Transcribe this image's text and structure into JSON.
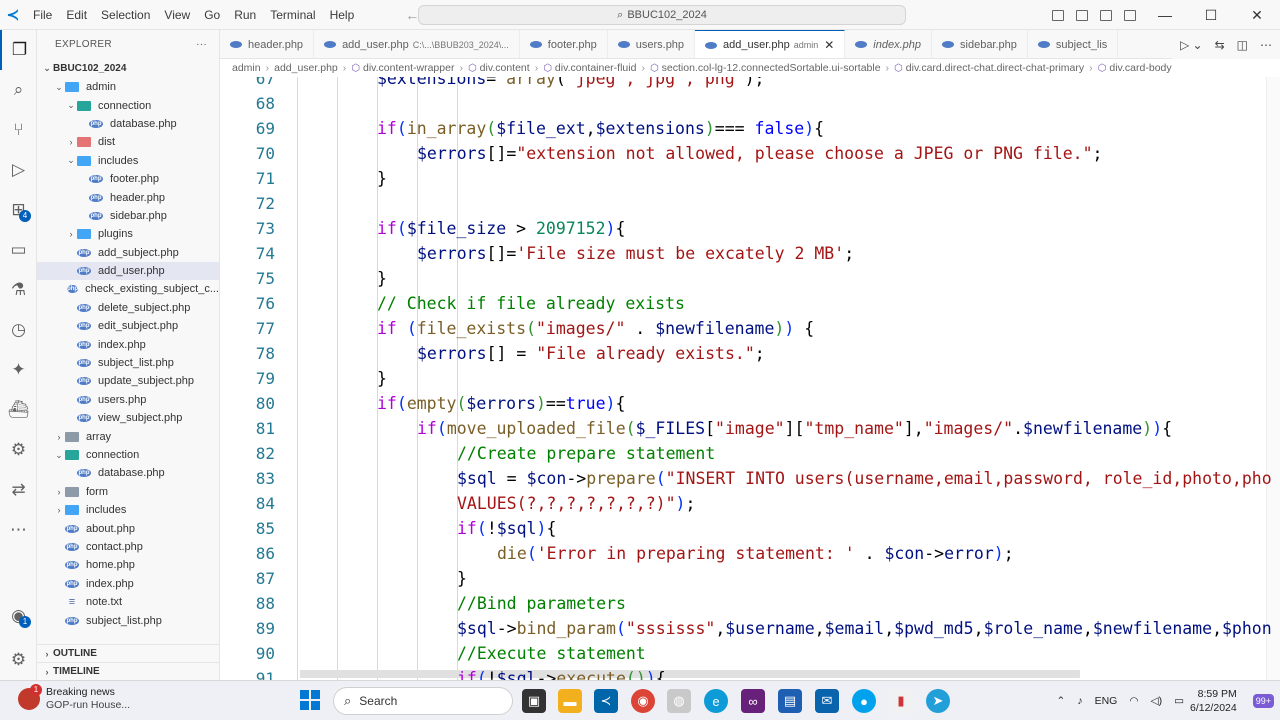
{
  "titlebar": {
    "menu": [
      "File",
      "Edit",
      "Selection",
      "View",
      "Go",
      "Run",
      "Terminal",
      "Help"
    ],
    "search_text": "BBUC102_2024"
  },
  "sidebar": {
    "header": "EXPLORER",
    "more": "···",
    "root": "BBUC102_2024",
    "tree": [
      {
        "label": "admin",
        "depth": 1,
        "kind": "folder",
        "color": "blue",
        "open": true
      },
      {
        "label": "connection",
        "depth": 2,
        "kind": "folder",
        "color": "teal",
        "open": true
      },
      {
        "label": "database.php",
        "depth": 3,
        "kind": "php"
      },
      {
        "label": "dist",
        "depth": 2,
        "kind": "folder",
        "color": "red",
        "open": false
      },
      {
        "label": "includes",
        "depth": 2,
        "kind": "folder",
        "color": "blue",
        "open": true
      },
      {
        "label": "footer.php",
        "depth": 3,
        "kind": "php"
      },
      {
        "label": "header.php",
        "depth": 3,
        "kind": "php"
      },
      {
        "label": "sidebar.php",
        "depth": 3,
        "kind": "php"
      },
      {
        "label": "plugins",
        "depth": 2,
        "kind": "folder",
        "color": "blue",
        "open": false
      },
      {
        "label": "add_subject.php",
        "depth": 2,
        "kind": "php"
      },
      {
        "label": "add_user.php",
        "depth": 2,
        "kind": "php",
        "selected": true
      },
      {
        "label": "check_existing_subject_c...",
        "depth": 2,
        "kind": "php"
      },
      {
        "label": "delete_subject.php",
        "depth": 2,
        "kind": "php"
      },
      {
        "label": "edit_subject.php",
        "depth": 2,
        "kind": "php"
      },
      {
        "label": "index.php",
        "depth": 2,
        "kind": "php"
      },
      {
        "label": "subject_list.php",
        "depth": 2,
        "kind": "php"
      },
      {
        "label": "update_subject.php",
        "depth": 2,
        "kind": "php"
      },
      {
        "label": "users.php",
        "depth": 2,
        "kind": "php"
      },
      {
        "label": "view_subject.php",
        "depth": 2,
        "kind": "php"
      },
      {
        "label": "array",
        "depth": 1,
        "kind": "folder",
        "color": "grey",
        "open": false
      },
      {
        "label": "connection",
        "depth": 1,
        "kind": "folder",
        "color": "teal",
        "open": true
      },
      {
        "label": "database.php",
        "depth": 2,
        "kind": "php"
      },
      {
        "label": "form",
        "depth": 1,
        "kind": "folder",
        "color": "grey",
        "open": false
      },
      {
        "label": "includes",
        "depth": 1,
        "kind": "folder",
        "color": "blue",
        "open": false
      },
      {
        "label": "about.php",
        "depth": 1,
        "kind": "php"
      },
      {
        "label": "contact.php",
        "depth": 1,
        "kind": "php"
      },
      {
        "label": "home.php",
        "depth": 1,
        "kind": "php"
      },
      {
        "label": "index.php",
        "depth": 1,
        "kind": "php"
      },
      {
        "label": "note.txt",
        "depth": 1,
        "kind": "txt"
      },
      {
        "label": "subject_list.php",
        "depth": 1,
        "kind": "php"
      }
    ],
    "outline": "OUTLINE",
    "timeline": "TIMELINE"
  },
  "tabs": [
    {
      "label": "header.php",
      "sub": "",
      "active": false,
      "italic": false
    },
    {
      "label": "add_user.php",
      "sub": "C:\\...\\BBUB203_2024\\...",
      "active": false,
      "italic": false
    },
    {
      "label": "footer.php",
      "sub": "",
      "active": false,
      "italic": false
    },
    {
      "label": "users.php",
      "sub": "",
      "active": false,
      "italic": false
    },
    {
      "label": "add_user.php",
      "sub": "admin",
      "active": true,
      "italic": false
    },
    {
      "label": "index.php",
      "sub": "",
      "active": false,
      "italic": true
    },
    {
      "label": "sidebar.php",
      "sub": "",
      "active": false,
      "italic": false
    },
    {
      "label": "subject_lis",
      "sub": "",
      "active": false,
      "italic": false
    }
  ],
  "breadcrumb": [
    "admin",
    "add_user.php",
    "div.content-wrapper",
    "div.content",
    "div.container-fluid",
    "section.col-lg-12.connectedSortable.ui-sortable",
    "div.card.direct-chat.direct-chat-primary",
    "div.card-body"
  ],
  "editor": {
    "lines": [
      {
        "n": "67",
        "indent": 0,
        "html": "<span class='var'>$extensions</span>= <span class='fn'>array</span>(<span class='str'>\"jpeg\",\"jpg\",\"png\"</span>);"
      },
      {
        "n": "68",
        "indent": 0,
        "html": ""
      },
      {
        "n": "69",
        "indent": 0,
        "html": "<span class='ctl'>if</span><span class='p1'>(</span><span class='fn'>in_array</span><span class='p2'>(</span><span class='var'>$file_ext</span>,<span class='var'>$extensions</span><span class='p2'>)</span>=== <span class='bool'>false</span><span class='p1'>)</span>{"
      },
      {
        "n": "70",
        "indent": 1,
        "html": "<span class='var'>$errors</span>[]=<span class='str'>\"extension not allowed, please choose a JPEG or PNG file.\"</span>;"
      },
      {
        "n": "71",
        "indent": 0,
        "html": "}"
      },
      {
        "n": "72",
        "indent": 0,
        "html": ""
      },
      {
        "n": "73",
        "indent": 0,
        "html": "<span class='ctl'>if</span><span class='p1'>(</span><span class='var'>$file_size</span> &gt; <span class='num'>2097152</span><span class='p1'>)</span>{"
      },
      {
        "n": "74",
        "indent": 1,
        "html": "<span class='var'>$errors</span>[]=<span class='str'>'File size must be excately 2 MB'</span>;"
      },
      {
        "n": "75",
        "indent": 0,
        "html": "}"
      },
      {
        "n": "76",
        "indent": 0,
        "html": "<span class='com'>// Check if file already exists</span>"
      },
      {
        "n": "77",
        "indent": 0,
        "html": "<span class='ctl'>if</span> <span class='p1'>(</span><span class='fn'>file_exists</span><span class='p2'>(</span><span class='str'>\"images/\"</span> . <span class='var'>$newfilename</span><span class='p2'>)</span><span class='p1'>)</span> {"
      },
      {
        "n": "78",
        "indent": 1,
        "html": "<span class='var'>$errors</span>[] = <span class='str'>\"File already exists.\"</span>;"
      },
      {
        "n": "79",
        "indent": 0,
        "html": "}"
      },
      {
        "n": "80",
        "indent": 0,
        "html": "<span class='ctl'>if</span><span class='p1'>(</span><span class='fn'>empty</span><span class='p2'>(</span><span class='var'>$errors</span><span class='p2'>)</span>==<span class='bool'>true</span><span class='p1'>)</span>{"
      },
      {
        "n": "81",
        "indent": 1,
        "html": "<span class='ctl'>if</span><span class='p1'>(</span><span class='fn'>move_uploaded_file</span><span class='p2'>(</span><span class='var'>$_FILES</span>[<span class='str'>\"image\"</span>][<span class='str'>\"tmp_name\"</span>],<span class='str'>\"images/\"</span>.<span class='var'>$newfilename</span><span class='p2'>)</span><span class='p1'>)</span>{"
      },
      {
        "n": "82",
        "indent": 2,
        "html": "<span class='com'>//Create prepare statement</span>"
      },
      {
        "n": "83",
        "indent": 2,
        "html": "<span class='var'>$sql</span> = <span class='var'>$con</span>-&gt;<span class='fn'>prepare</span><span class='p1'>(</span><span class='str'>\"INSERT INTO users(username,email,password, role_id,photo,pho</span>"
      },
      {
        "n": "84",
        "indent": 2,
        "html": "<span class='str'>VALUES(?,?,?,?,?,?,?)\"</span><span class='p1'>)</span>;"
      },
      {
        "n": "85",
        "indent": 2,
        "html": "<span class='ctl'>if</span><span class='p1'>(</span>!<span class='var'>$sql</span><span class='p1'>)</span>{"
      },
      {
        "n": "86",
        "indent": 3,
        "html": "<span class='fn'>die</span><span class='p1'>(</span><span class='str'>'Error in preparing statement: '</span> . <span class='var'>$con</span>-&gt;<span class='var'>error</span><span class='p1'>)</span>;"
      },
      {
        "n": "87",
        "indent": 2,
        "html": "}"
      },
      {
        "n": "88",
        "indent": 2,
        "html": "<span class='com'>//Bind parameters</span>"
      },
      {
        "n": "89",
        "indent": 2,
        "html": "<span class='var'>$sql</span>-&gt;<span class='fn'>bind_param</span><span class='p1'>(</span><span class='str'>\"sssisss\"</span>,<span class='var'>$username</span>,<span class='var'>$email</span>,<span class='var'>$pwd_md5</span>,<span class='var'>$role_name</span>,<span class='var'>$newfilename</span>,<span class='var'>$phon</span>"
      },
      {
        "n": "90",
        "indent": 2,
        "html": "<span class='com'>//Execute statement</span>"
      },
      {
        "n": "91",
        "indent": 2,
        "html": "<span class='ctl'>if</span><span class='p1'>(</span>!<span class='var'>$sql</span>-&gt;<span class='fn'>execute</span><span class='p2'>()</span><span class='p1'>)</span>{"
      }
    ]
  },
  "taskbar": {
    "news_title": "Breaking news",
    "news_sub": "GOP-run House...",
    "news_badge": "1",
    "search": "Search",
    "lang": "ENG",
    "time": "8:59 PM",
    "date": "6/12/2024",
    "chat_badge": "99+"
  },
  "activity_badges": {
    "extensions": "4",
    "accounts": "1"
  }
}
